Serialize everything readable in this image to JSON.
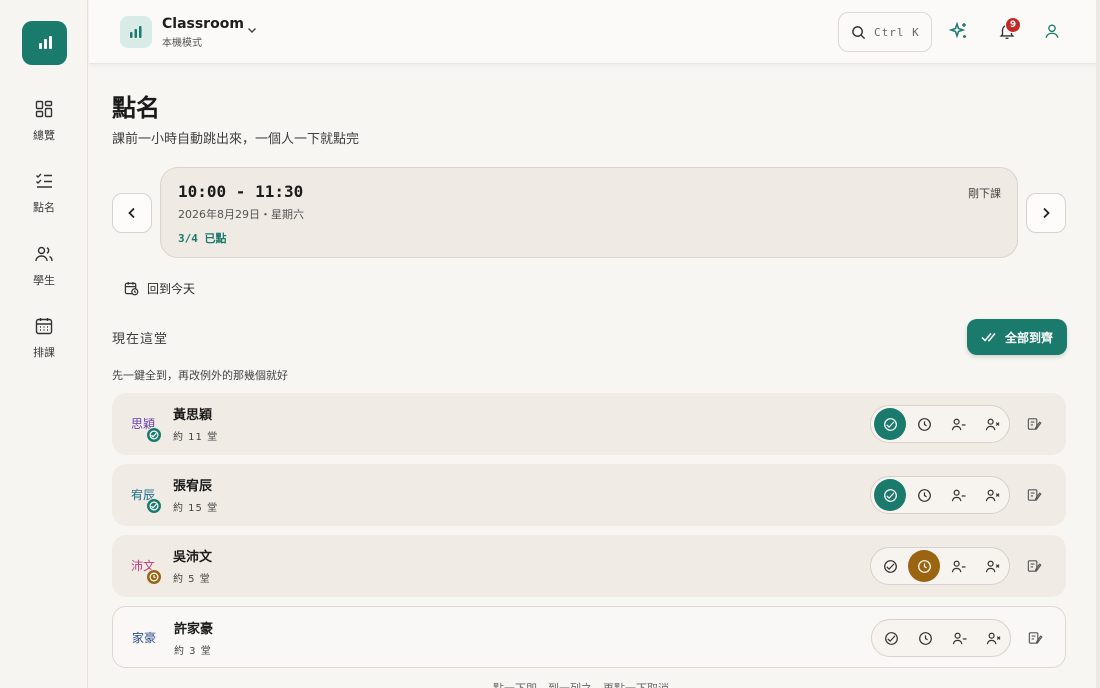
{
  "app": {
    "workspace_title": "Classroom",
    "workspace_mode": "本機模式",
    "search_shortcut": "Ctrl K",
    "notification_count": "9"
  },
  "sidebar": {
    "items": [
      {
        "label": "總覽",
        "icon": "dashboard-icon"
      },
      {
        "label": "點名",
        "icon": "checklist-icon"
      },
      {
        "label": "學生",
        "icon": "users-icon"
      },
      {
        "label": "排課",
        "icon": "calendar-icon"
      }
    ]
  },
  "page": {
    "title": "點名",
    "subtitle": "課前一小時自動跳出來，一個人一下就點完"
  },
  "session": {
    "time": "10:00 - 11:30",
    "date": "2026年8月29日・星期六",
    "count": "3/4 已點",
    "status": "剛下課"
  },
  "today_button": "回到今天",
  "section": {
    "title": "現在這堂",
    "hint": "先一鍵全到，再改例外的那幾個就好",
    "all_present_label": "全部到齊"
  },
  "students": [
    {
      "avatar": "思穎",
      "name": "黃思穎",
      "sessions": "約 11 堂",
      "status": "present",
      "avatar_color": "#6a3fb0"
    },
    {
      "avatar": "宥辰",
      "name": "張宥辰",
      "sessions": "約 15 堂",
      "status": "present",
      "avatar_color": "#1f6f8b"
    },
    {
      "avatar": "沛文",
      "name": "吳沛文",
      "sessions": "約 5 堂",
      "status": "late",
      "avatar_color": "#c23a7a"
    },
    {
      "avatar": "家豪",
      "name": "許家豪",
      "sessions": "約 3 堂",
      "status": "none",
      "avatar_color": "#2a4f8a"
    }
  ],
  "footer_hint": "點一下即，到一列之，再點一下取消",
  "colors": {
    "accent": "#1a7a6c",
    "late": "#9a6410",
    "alert": "#c22a2a"
  }
}
